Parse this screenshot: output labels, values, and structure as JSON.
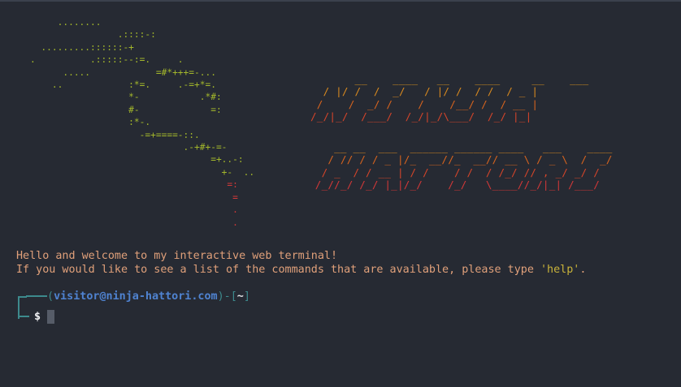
{
  "ascii_logo": [
    "         ........",
    "                    .::::-:",
    "      .........::::::-+",
    "    .          .:::::--:=.     .",
    "          .....            =#*+++=-...",
    "        ..            :*=.     .-=+*=.",
    "                      *-           .*#:",
    "                      #-             =:",
    "                      :*-.",
    "                        -=+====-::.",
    "                                .-+#+-=-",
    "                                     =+..-:",
    "                                       +-  ..",
    "                                        =:",
    "                                         =",
    "                                         .",
    "                                         ."
  ],
  "ninja_art": [
    "       __    ____   __    ____     __    ___",
    "  / |/ /  /  _/   / |/ /  / /  / _ |",
    " /    /  _/ /    /    /__/ /  / __ |",
    "/_/|_/  /___/  /_/|_/\\___/  /_/ |_|"
  ],
  "hattori_art": [
    "    __ __  ___  ______ ______ ____   ___    ____",
    "   / // / / _ |/_  __//_  __// __ \\ / _ \\  /  _/",
    "  / _  / / __ | / /    / /  / /_/ // , _/ _/ /",
    " /_//_/ /_/ |_|/_/    /_/   \\____//_/|_| /___/"
  ],
  "welcome": {
    "line1": "Hello and welcome to my interactive web terminal!",
    "line2_prefix": "If you would like to see a list of the commands that are available, please type ",
    "line2_command": "'help'",
    "line2_suffix": "."
  },
  "prompt": {
    "open": "(",
    "user_host": "visitor@ninja-hattori.com",
    "close": ")",
    "sep": "-[",
    "cwd": "~",
    "end": "]",
    "symbol": "$"
  },
  "colors": {
    "background": "#262a33",
    "logo": "#a3b72b",
    "welcome": "#e0a07a",
    "highlight": "#c9b33a",
    "prompt_line": "#3d8a8d",
    "user": "#4f83d1"
  }
}
